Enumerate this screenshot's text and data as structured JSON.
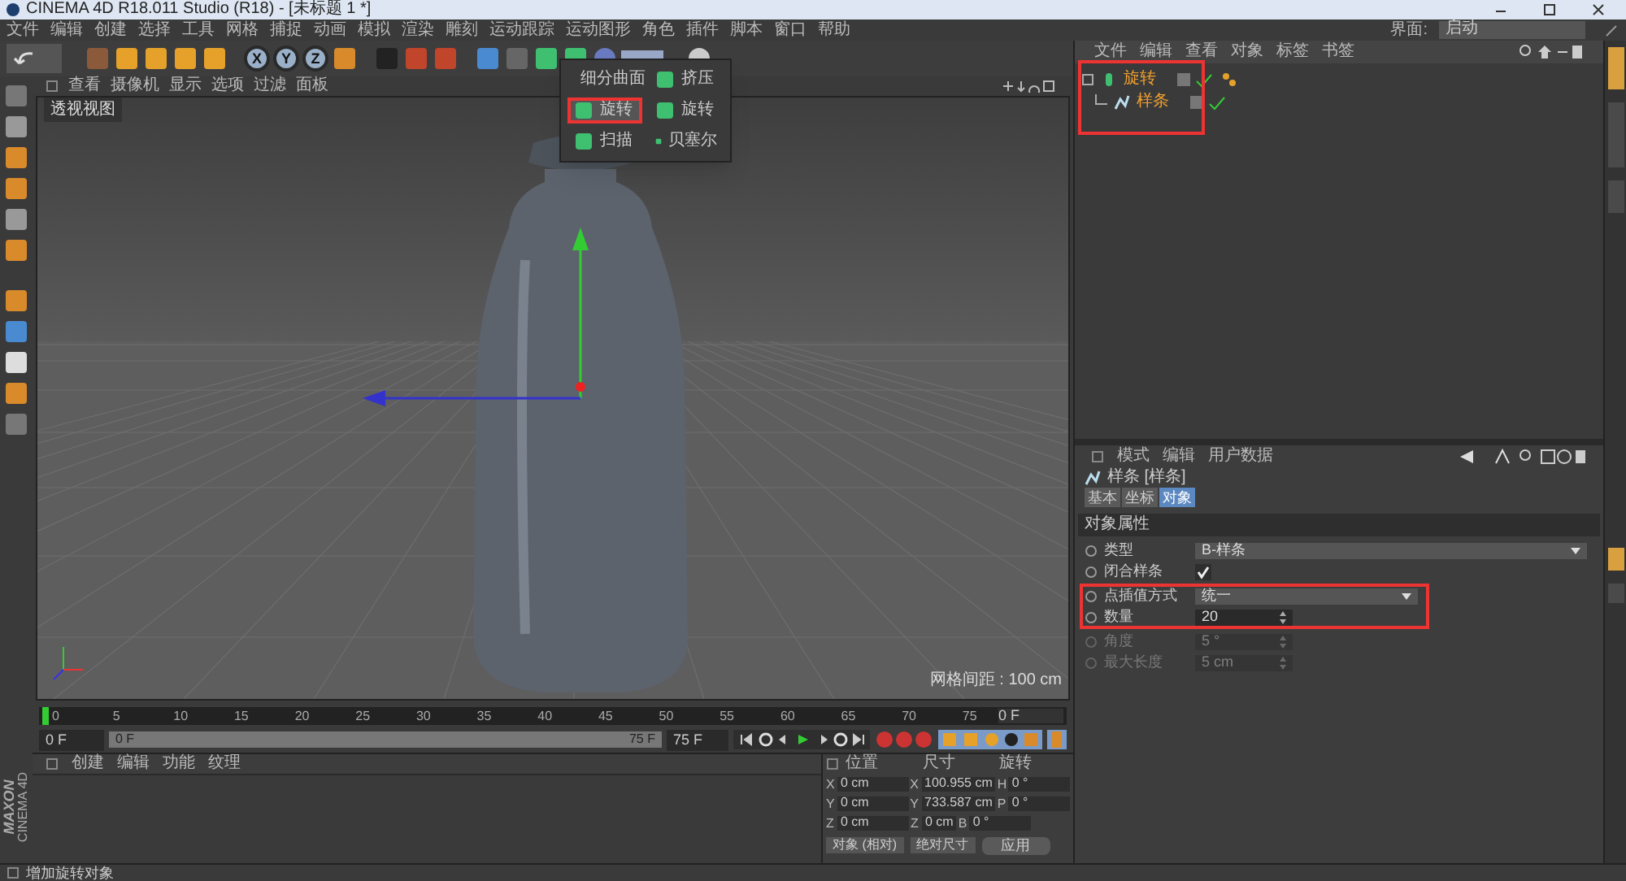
{
  "window": {
    "title": "CINEMA 4D R18.011 Studio (R18) - [未标题 1 *]"
  },
  "menu_bar": [
    "文件",
    "编辑",
    "创建",
    "选择",
    "工具",
    "网格",
    "捕捉",
    "动画",
    "模拟",
    "渲染",
    "雕刻",
    "运动跟踪",
    "运动图形",
    "角色",
    "插件",
    "脚本",
    "窗口",
    "帮助"
  ],
  "layout": {
    "label": "界面:",
    "value": "启动"
  },
  "toolbar": {
    "axis_buttons": [
      "X",
      "Y",
      "Z"
    ]
  },
  "viewport": {
    "menu": [
      "查看",
      "摄像机",
      "显示",
      "选项",
      "过滤",
      "面板"
    ],
    "label": "透视视图",
    "grid_spacing": "网格间距 : 100 cm"
  },
  "popup_menu": {
    "items": [
      {
        "label": "细分曲面",
        "selected": false
      },
      {
        "label": "挤压",
        "selected": false
      },
      {
        "label": "旋转",
        "selected": true
      },
      {
        "label": "旋转",
        "selected": false
      },
      {
        "label": "扫描",
        "selected": false
      },
      {
        "label": "贝塞尔",
        "selected": false
      }
    ]
  },
  "object_manager": {
    "menu": [
      "文件",
      "编辑",
      "查看",
      "对象",
      "标签",
      "书签"
    ],
    "highlighted": true,
    "objects": [
      {
        "name": "旋转",
        "children": [
          {
            "name": "样条"
          }
        ]
      }
    ]
  },
  "attributes": {
    "menu": [
      "模式",
      "编辑",
      "用户数据"
    ],
    "object_title": "样条 [样条]",
    "tabs": [
      {
        "label": "基本",
        "selected": false
      },
      {
        "label": "坐标",
        "selected": false
      },
      {
        "label": "对象",
        "selected": true
      }
    ],
    "section": "对象属性",
    "fields": [
      {
        "label": "类型",
        "kind": "dropdown",
        "value": "B-样条",
        "disabled": false,
        "highlighted": false
      },
      {
        "label": "闭合样条",
        "kind": "checkbox",
        "checked": true,
        "disabled": false,
        "highlighted": false
      },
      {
        "label": "点插值方式",
        "kind": "dropdown",
        "value": "统一",
        "disabled": false,
        "highlighted": true
      },
      {
        "label": "数量",
        "kind": "number",
        "value": "20",
        "disabled": false,
        "highlighted": true
      },
      {
        "label": "角度",
        "kind": "number",
        "value": "5 °",
        "disabled": true,
        "highlighted": false
      },
      {
        "label": "最大长度",
        "kind": "number",
        "value": "5 cm",
        "disabled": true,
        "highlighted": false
      }
    ]
  },
  "timeline": {
    "ticks": [
      "0",
      "5",
      "10",
      "15",
      "20",
      "25",
      "30",
      "35",
      "40",
      "45",
      "50",
      "55",
      "60",
      "65",
      "70",
      "75"
    ],
    "current_frame": "0 F",
    "start": "0 F",
    "range_start": "0 F",
    "range_end": "75 F",
    "end": "75 F"
  },
  "material_manager": {
    "menu": [
      "创建",
      "编辑",
      "功能",
      "纹理"
    ]
  },
  "coordinates": {
    "headers": [
      "位置",
      "尺寸",
      "旋转"
    ],
    "rows": [
      {
        "axis": "X",
        "position": "0 cm",
        "size_axis": "X",
        "size": "100.955 cm",
        "rotation_axis": "H",
        "rotation": "0 °"
      },
      {
        "axis": "Y",
        "position": "0 cm",
        "size_axis": "Y",
        "size": "733.587 cm",
        "rotation_axis": "P",
        "rotation": "0 °"
      },
      {
        "axis": "Z",
        "position": "0 cm",
        "size_axis": "Z",
        "size": "0 cm",
        "rotation_axis": "B",
        "rotation": "0 °"
      }
    ],
    "dropdowns": [
      "对象 (相对)",
      "绝对尺寸"
    ],
    "apply": "应用"
  },
  "brand": [
    "MAXON",
    "CINEMA 4D"
  ],
  "status_bar": "增加旋转对象"
}
